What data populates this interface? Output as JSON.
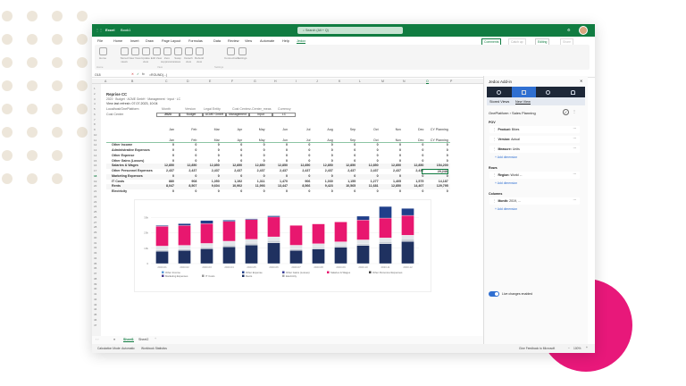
{
  "app": {
    "name": "Excel",
    "doc": "Book1",
    "search_placeholder": "Search (Alt + Q)"
  },
  "menu": [
    "File",
    "Home",
    "Insert",
    "Draw",
    "Page Layout",
    "Formulas",
    "Data",
    "Review",
    "View",
    "Automate",
    "Help",
    "Jedox"
  ],
  "actions": {
    "comments": "Comments",
    "catchup": "Catch up",
    "editing": "Editing",
    "share": "Share"
  },
  "ribbon": [
    {
      "label": "Home",
      "group": "Home"
    },
    {
      "label": "Stored views",
      "group": "View"
    },
    {
      "label": "New View",
      "group": "View"
    },
    {
      "label": "Update view",
      "group": "View"
    },
    {
      "label": "Edit View",
      "group": "View"
    },
    {
      "label": "Zero suppression",
      "group": "View"
    },
    {
      "label": "Swap axes",
      "group": "View"
    },
    {
      "label": "Detach view",
      "group": "View"
    },
    {
      "label": "Rebuild view",
      "group": "View"
    },
    {
      "label": "Connections",
      "group": "Settings"
    },
    {
      "label": "Settings",
      "group": "Settings"
    }
  ],
  "ribbon_groups": [
    "Home",
    "View",
    "Settings"
  ],
  "formula": {
    "cell": "O18",
    "value": "=ROUND(...)"
  },
  "columns": [
    "A",
    "B",
    "C",
    "D",
    "E",
    "F",
    "G",
    "H",
    "I",
    "J",
    "K",
    "L",
    "M",
    "N",
    "O",
    "P"
  ],
  "sheet": {
    "title": "Reprise CC",
    "subtitle": "2023 · Budget · ACME GmbH · Management · Input · LC",
    "refresh": "View last refresh: 07.07.2023, 10:04",
    "source": "Localhost/OnePlatform",
    "pov_headers": [
      "Month",
      "Version",
      "Legal Entity",
      "Cost Center",
      "z-Center_meas",
      "Currency"
    ],
    "pov_label": "Cost Center",
    "pov_values": [
      "2023",
      "Budget",
      "ACME GmbH",
      "Management",
      "Input",
      "LC"
    ],
    "months": [
      "Jan",
      "Feb",
      "Mar",
      "Apr",
      "May",
      "Jun",
      "Jul",
      "Aug",
      "Sep",
      "Oct",
      "Nov",
      "Dec",
      "CY Planning"
    ],
    "rows": [
      {
        "label": "Other Income",
        "values": [
          "0",
          "0",
          "0",
          "0",
          "0",
          "0",
          "0",
          "0",
          "0",
          "0",
          "0",
          "0",
          "0"
        ]
      },
      {
        "label": "Administrative Expenses",
        "values": [
          "0",
          "0",
          "0",
          "0",
          "0",
          "0",
          "0",
          "0",
          "0",
          "0",
          "0",
          "0",
          "0"
        ]
      },
      {
        "label": "Other Expense",
        "values": [
          "0",
          "0",
          "0",
          "0",
          "0",
          "0",
          "0",
          "0",
          "0",
          "0",
          "0",
          "0",
          "0"
        ]
      },
      {
        "label": "Other Gains (Losses)",
        "values": [
          "0",
          "0",
          "0",
          "0",
          "0",
          "0",
          "0",
          "0",
          "0",
          "0",
          "0",
          "0",
          "0"
        ]
      },
      {
        "label": "Salaries & Wages",
        "values": [
          "12,850",
          "12,850",
          "12,850",
          "12,850",
          "12,850",
          "12,850",
          "12,850",
          "12,850",
          "12,850",
          "12,850",
          "12,850",
          "12,850",
          "154,200"
        ]
      },
      {
        "label": "Other Personnel Expenses",
        "values": [
          "2,437",
          "2,437",
          "2,437",
          "2,437",
          "2,437",
          "2,437",
          "2,437",
          "2,437",
          "2,437",
          "2,437",
          "2,437",
          "2,437",
          "29,248"
        ]
      },
      {
        "label": "Marketing Expenses",
        "values": [
          "0",
          "0",
          "0",
          "0",
          "0",
          "0",
          "0",
          "0",
          "0",
          "0",
          "0",
          "0",
          "0"
        ]
      },
      {
        "label": "IT Costs",
        "values": [
          "880",
          "908",
          "1,050",
          "1,192",
          "1,311",
          "1,470",
          "906",
          "1,030",
          "1,155",
          "1,277",
          "1,405",
          "1,575",
          "14,187"
        ]
      },
      {
        "label": "Rents",
        "values": [
          "8,047",
          "8,507",
          "9,604",
          "10,902",
          "11,993",
          "13,447",
          "8,566",
          "9,423",
          "10,565",
          "11,681",
          "12,850",
          "14,407",
          "129,795"
        ]
      },
      {
        "label": "Electricity",
        "values": [
          "0",
          "0",
          "0",
          "0",
          "0",
          "0",
          "0",
          "0",
          "0",
          "0",
          "0",
          "0",
          "0"
        ]
      }
    ]
  },
  "chart_data": {
    "type": "bar",
    "stacked": true,
    "categories": [
      "2023-01",
      "2023-02",
      "2023-03",
      "2023-04",
      "2023-05",
      "2023-06",
      "2023-07",
      "2023-08",
      "2023-09",
      "2023-10",
      "2023-11",
      "2023-12"
    ],
    "yticks": [
      "0",
      "10k",
      "20k",
      "30k"
    ],
    "ylim": [
      0,
      40000
    ],
    "series": [
      {
        "name": "Rents",
        "color": "#1f3160",
        "values": [
          8047,
          8507,
          9604,
          10902,
          11993,
          13447,
          8566,
          9423,
          10565,
          11681,
          12850,
          14407
        ]
      },
      {
        "name": "IT Costs",
        "color": "#c9ced6",
        "values": [
          880,
          908,
          1050,
          1192,
          1311,
          1470,
          906,
          1030,
          1155,
          1277,
          1405,
          1575
        ]
      },
      {
        "name": "Other Personnel Expenses",
        "color": "#e3e6ea",
        "values": [
          2437,
          2437,
          2437,
          2437,
          2437,
          2437,
          2437,
          2437,
          2437,
          2437,
          2437,
          2437
        ]
      },
      {
        "name": "Salaries & Wages",
        "color": "#e8176f",
        "values": [
          12850,
          12850,
          12850,
          12850,
          12850,
          12850,
          12850,
          12850,
          12850,
          12850,
          12850,
          12850
        ]
      },
      {
        "name": "Other Expense",
        "color": "#203f8a",
        "values": [
          500,
          1200,
          2000,
          800,
          500,
          800,
          0,
          0,
          0,
          2500,
          7500,
          4500
        ]
      }
    ],
    "legend": [
      {
        "name": "Other Income",
        "color": "#5a9bd8"
      },
      {
        "name": "Other Expense",
        "color": "#203f8a"
      },
      {
        "name": "Other Gains (Losses)",
        "color": "#3a3f9a"
      },
      {
        "name": "Salaries & Wages",
        "color": "#e8176f"
      },
      {
        "name": "Other Personnel Expenses",
        "color": "#444444"
      },
      {
        "name": "Marketing Expenses",
        "color": "#4b3c8f"
      },
      {
        "name": "IT Costs",
        "color": "#999999"
      },
      {
        "name": "Rents",
        "color": "#1f3160"
      },
      {
        "name": "Electricity",
        "color": "#aaaaaa"
      }
    ]
  },
  "pane": {
    "title": "Jedox Add-in",
    "tabs": [
      "Stored Views",
      "New View"
    ],
    "path": "OnePlatform › Sales Planning",
    "sections": [
      {
        "title": "POV",
        "items": [
          {
            "key": "Product:",
            "val": "Bikes"
          },
          {
            "key": "Version:",
            "val": "Actual"
          },
          {
            "key": "Measure:",
            "val": "Units"
          }
        ]
      },
      {
        "title": "Rows",
        "items": [
          {
            "key": "Region:",
            "val": "World ..."
          }
        ]
      },
      {
        "title": "Columns",
        "items": [
          {
            "key": "Month:",
            "val": "2019, ..."
          }
        ]
      }
    ],
    "add_dimension": "Add dimension",
    "live": "Live changes enabled"
  },
  "sheet_tabs": [
    "Sheet1",
    "Sheet2"
  ],
  "status": {
    "calc": "Calculation Mode: Automatic",
    "stats": "Workbook Statistics",
    "feedback": "Give Feedback to Microsoft",
    "zoom": "100%"
  },
  "colors": {
    "excel_green": "#107c41",
    "accent_pink": "#e8187a",
    "pane_blue": "#2f6fd1"
  }
}
